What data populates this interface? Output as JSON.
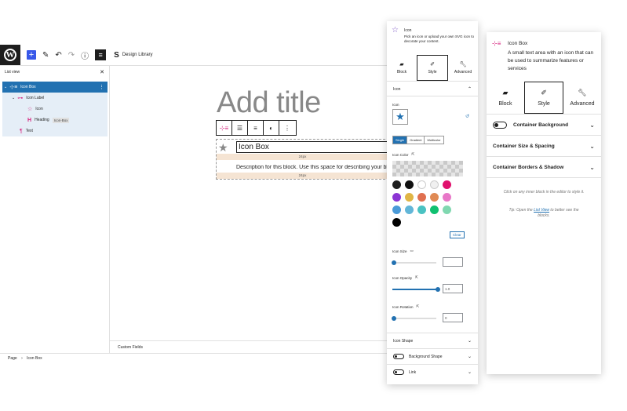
{
  "topbar": {
    "design_library_label": "Design Library"
  },
  "list_view": {
    "title": "List view",
    "items": [
      {
        "label": "Icon Box"
      },
      {
        "label": "Icon Label"
      },
      {
        "label": "Icon"
      },
      {
        "label": "Heading",
        "badge": "Icon-Box"
      },
      {
        "label": "Text"
      }
    ]
  },
  "canvas": {
    "title_placeholder": "Add title",
    "block_title": "Icon Box",
    "spacer_label": "24px",
    "description": "Description for this block. Use this space for describing your block."
  },
  "custom_fields_label": "Custom Fields",
  "breadcrumb": {
    "page": "Page",
    "separator": "›",
    "current": "Icon Box"
  },
  "mid_panel": {
    "block_title": "Icon",
    "block_desc": "Pick an icon or upload your own SVG icon to decorate your content.",
    "tabs": [
      {
        "label": "Block"
      },
      {
        "label": "Style"
      },
      {
        "label": "Advanced"
      }
    ],
    "icon_section": "Icon",
    "icon_label": "Icon",
    "color_type_options": [
      "Single",
      "Gradient",
      "Multicolor"
    ],
    "color_type_selected": "Single",
    "icon_color_label": "Icon Color",
    "swatches": [
      "#1e1e1e",
      "#111111",
      "#ffffff",
      "#f0f0f0",
      "#e0116d",
      "#8c35d4",
      "#e0b545",
      "#e07050",
      "#e08a55",
      "#e878c8",
      "#4a9ad8",
      "#62b6d8",
      "#4ac2c2",
      "#10c070",
      "#80d8b0",
      "#000000"
    ],
    "clear_label": "Clear",
    "icon_size_label": "Icon Size",
    "icon_size_value": "",
    "icon_opacity_label": "Icon Opacity",
    "icon_opacity_value": "1.0",
    "icon_rotation_label": "Icon Rotation",
    "icon_rotation_value": "0",
    "icon_shape_label": "Icon Shape",
    "background_shape_label": "Background Shape",
    "link_label": "Link"
  },
  "right_panel": {
    "block_title": "Icon Box",
    "block_desc": "A small text area with an icon that can be used to summarize features or services",
    "tabs": [
      {
        "label": "Block"
      },
      {
        "label": "Style"
      },
      {
        "label": "Advanced"
      }
    ],
    "sections": [
      {
        "label": "Container Background"
      },
      {
        "label": "Container Size & Spacing"
      },
      {
        "label": "Container Borders & Shadow"
      }
    ],
    "hint1": "Click on any inner block in the editor to style it.",
    "hint2_prefix": "Tip: Open the",
    "hint2_link": "List View",
    "hint2_suffix": "to better see the blocks."
  }
}
